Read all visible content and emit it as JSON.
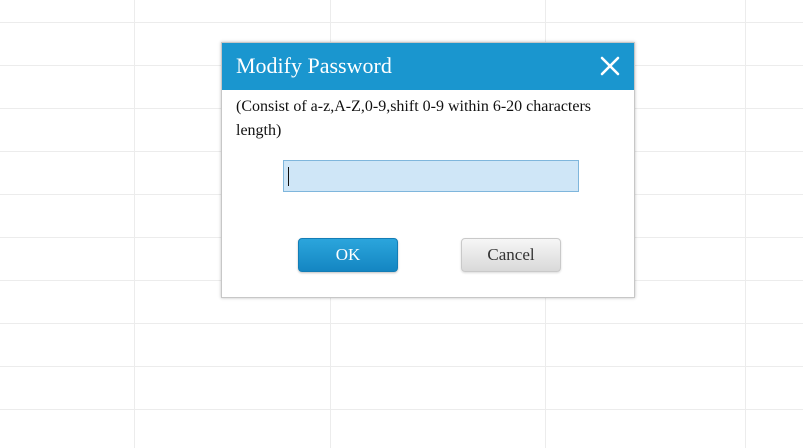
{
  "dialog": {
    "title": "Modify Password",
    "hint": "(Consist of a-z,A-Z,0-9,shift 0-9 within 6-20 characters length)",
    "password_value": "",
    "ok_label": "OK",
    "cancel_label": "Cancel",
    "close_icon": "close-icon"
  },
  "colors": {
    "titlebar": "#1a96cf",
    "input_background": "#cfe6f7",
    "ok_button": "#1b93cf",
    "cancel_button": "#e6e6e6"
  }
}
